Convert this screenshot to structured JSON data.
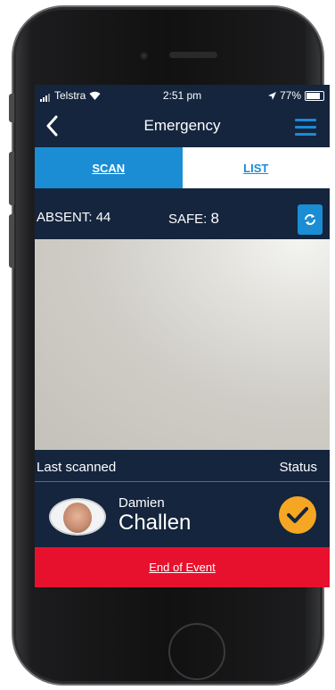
{
  "status_bar": {
    "carrier": "Telstra",
    "time": "2:51 pm",
    "battery": "77%"
  },
  "nav": {
    "title": "Emergency"
  },
  "tabs": [
    {
      "label": "SCAN",
      "active": true
    },
    {
      "label": "LIST",
      "active": false
    }
  ],
  "counts": {
    "absent_label": "ABSENT:",
    "absent_value": "44",
    "safe_label": "SAFE:",
    "safe_value": "8"
  },
  "scan": {
    "last_scanned_label": "Last scanned",
    "status_label": "Status"
  },
  "person": {
    "first_name": "Damien",
    "last_name": "Challen"
  },
  "end_event": {
    "label": "End of Event"
  },
  "colors": {
    "accent": "#1a8dd4",
    "background": "#14253d",
    "end_bar": "#e8112d",
    "status_check": "#f5a623"
  },
  "icons": [
    "back-chevron-icon",
    "hamburger-menu-icon",
    "refresh-icon",
    "checkmark-icon",
    "wifi-icon",
    "signal-icon",
    "location-icon",
    "battery-icon"
  ]
}
